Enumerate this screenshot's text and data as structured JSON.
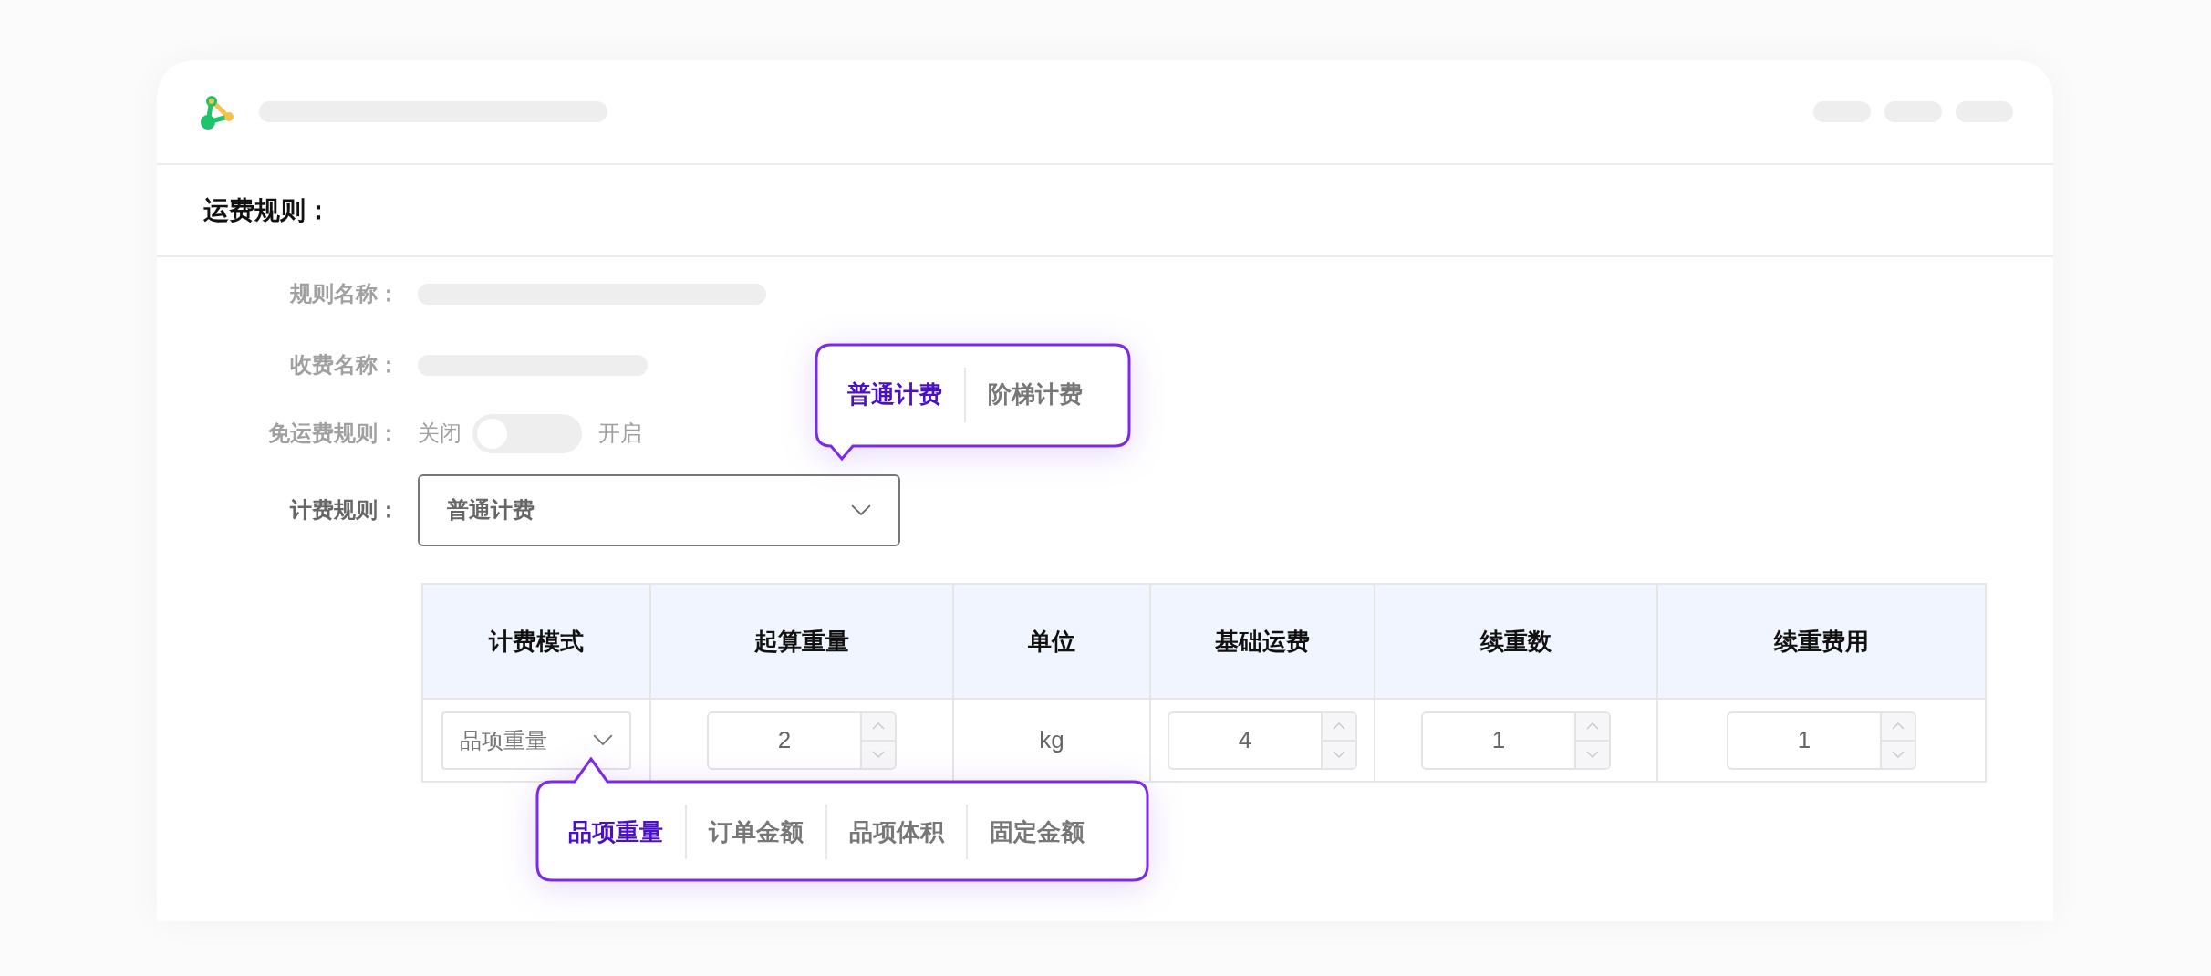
{
  "section_title": "运费规则：",
  "fields": [
    {
      "label": "规则名称：",
      "kind": "skeleton"
    },
    {
      "label": "收费名称：",
      "kind": "skeleton"
    },
    {
      "label": "免运费规则：",
      "kind": "switch",
      "off_label": "关闭",
      "on_label": "开启",
      "on": false
    },
    {
      "label": "计费规则：",
      "kind": "select",
      "value": "普通计费"
    }
  ],
  "billing_popover": {
    "options": [
      {
        "label": "普通计费",
        "selected": true
      },
      {
        "label": "阶梯计费",
        "selected": false
      }
    ]
  },
  "table": {
    "columns": [
      "计费模式",
      "起算重量",
      "单位",
      "基础运费",
      "续重数",
      "续重费用"
    ],
    "rows": [
      {
        "cells": [
          {
            "kind": "select",
            "value": "品项重量"
          },
          {
            "kind": "number",
            "value": "2"
          },
          {
            "kind": "text",
            "value": "kg"
          },
          {
            "kind": "number",
            "value": "4"
          },
          {
            "kind": "number",
            "value": "1"
          },
          {
            "kind": "number",
            "value": "1"
          }
        ]
      }
    ]
  },
  "mode_popover": {
    "options": [
      {
        "label": "品项重量",
        "selected": true
      },
      {
        "label": "订单金额",
        "selected": false
      },
      {
        "label": "品项体积",
        "selected": false
      },
      {
        "label": "固定金额",
        "selected": false
      }
    ]
  }
}
